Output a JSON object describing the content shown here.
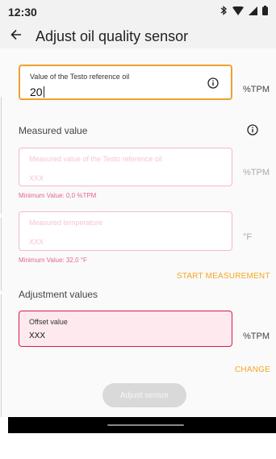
{
  "status_bar": {
    "time": "12:30",
    "icons": [
      "bluetooth-icon",
      "wifi-icon",
      "signal-icon",
      "battery-icon"
    ]
  },
  "app_bar": {
    "title": "Adjust oil quality sensor",
    "back_icon": "arrow-left-icon"
  },
  "reference_field": {
    "label": "Value of the Testo reference oil",
    "value": "20",
    "unit": "%TPM",
    "icon": "info-icon"
  },
  "measured_section": {
    "title": "Measured value",
    "icon": "info-icon",
    "measured_field": {
      "label": "Measured value of the Testo reference oil",
      "value": "XXX",
      "unit": "%TPM",
      "helper": "Minimum Value: 0,0 %TPM"
    },
    "temperature_field": {
      "label": "Measured temperature",
      "value": "XXX",
      "unit": "°F",
      "helper": "Minimum Value: 32,0 °F"
    },
    "start_action": "START MEASUREMENT"
  },
  "adjustment_section": {
    "title": "Adjustment values",
    "offset_field": {
      "label": "Offset value",
      "value": "XXX",
      "unit": "%TPM"
    },
    "change_action": "CHANGE"
  },
  "adjust_button": {
    "label": "Adjust sensor"
  },
  "colors": {
    "accent": "#f5a623",
    "error": "#d81b4a",
    "error_faint": "#f3b9c8",
    "disabled_button": "#d9d9d9"
  }
}
